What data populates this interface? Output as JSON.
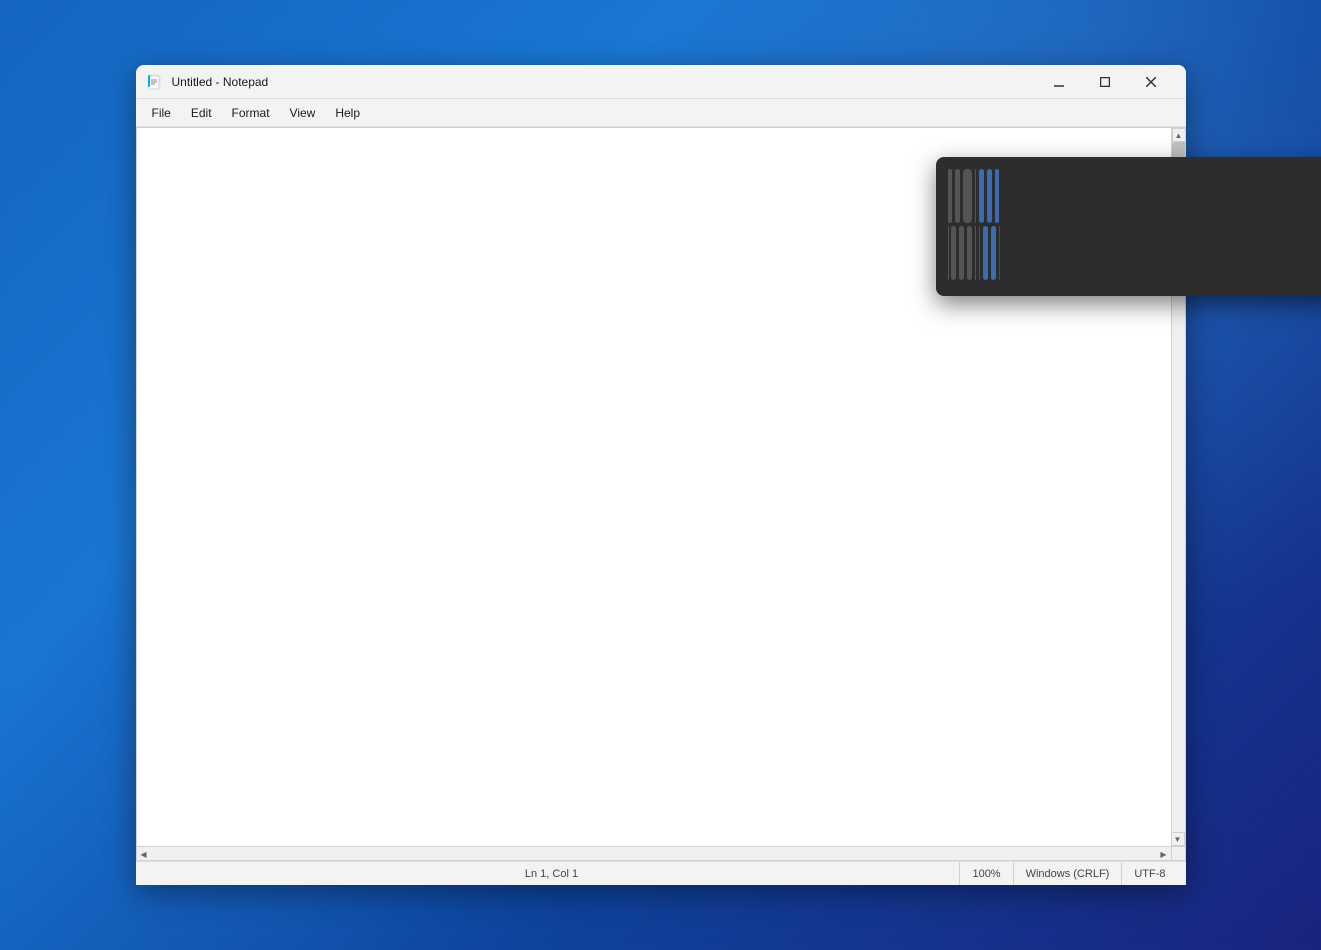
{
  "window": {
    "title": "Untitled - Notepad",
    "icon": "📝"
  },
  "titleBar": {
    "title": "Untitled - Notepad",
    "minimizeLabel": "–",
    "maximizeLabel": "□",
    "closeLabel": "✕"
  },
  "menuBar": {
    "items": [
      "File",
      "Edit",
      "Format",
      "View",
      "Help"
    ]
  },
  "editor": {
    "content": "",
    "placeholder": ""
  },
  "statusBar": {
    "position": "Ln 1, Col 1",
    "zoom": "100%",
    "lineEnding": "Windows (CRLF)",
    "encoding": "UTF-8"
  },
  "snapLayout": {
    "cells": [
      {
        "id": 1,
        "color": "gray",
        "col": "1/3",
        "row": "1"
      },
      {
        "id": 2,
        "color": "gray",
        "col": "3/5",
        "row": "1"
      },
      {
        "id": 3,
        "color": "gray",
        "col": "5/8",
        "row": "1"
      },
      {
        "id": 4,
        "color": "gray",
        "col": "8/9",
        "row": "1"
      },
      {
        "id": 5,
        "color": "blue",
        "col": "9/11",
        "row": "1"
      },
      {
        "id": 6,
        "color": "blue",
        "col": "11/13",
        "row": "1"
      },
      {
        "id": 7,
        "color": "blue",
        "col": "13/15",
        "row": "1"
      },
      {
        "id": 8,
        "color": "gray",
        "col": "1/2",
        "row": "2"
      },
      {
        "id": 9,
        "color": "gray",
        "col": "2/4",
        "row": "2"
      },
      {
        "id": 10,
        "color": "gray",
        "col": "4/6",
        "row": "2"
      },
      {
        "id": 11,
        "color": "gray",
        "col": "6/8",
        "row": "2"
      },
      {
        "id": 12,
        "color": "gray",
        "col": "8/9",
        "row": "2"
      },
      {
        "id": 13,
        "color": "blue",
        "col": "9/10",
        "row": "2"
      },
      {
        "id": 14,
        "color": "blue",
        "col": "10/12",
        "row": "2"
      },
      {
        "id": 15,
        "color": "blue",
        "col": "12/14",
        "row": "2"
      },
      {
        "id": 16,
        "color": "blue",
        "col": "14/15",
        "row": "2"
      }
    ]
  }
}
